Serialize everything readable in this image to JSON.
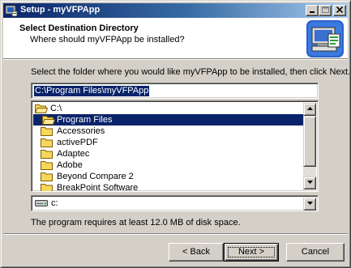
{
  "window": {
    "title": "Setup - myVFPApp",
    "controls": {
      "minimize": "_",
      "maximize": "□",
      "close": "×"
    }
  },
  "header": {
    "title": "Select Destination Directory",
    "subtitle": "Where should myVFPApp be installed?",
    "logo_icon": "computer-install-icon"
  },
  "body": {
    "instruction": "Select the folder where you would like myVFPApp to be installed, then click Next.",
    "path_value": "C:\\Program Files\\myVFPApp",
    "directories": [
      {
        "label": "C:\\",
        "icon": "open-folder-icon",
        "indent": 0,
        "selected": false
      },
      {
        "label": "Program Files",
        "icon": "open-folder-icon",
        "indent": 1,
        "selected": true
      },
      {
        "label": "Accessories",
        "icon": "folder-icon",
        "indent": 2,
        "selected": false
      },
      {
        "label": "activePDF",
        "icon": "folder-icon",
        "indent": 2,
        "selected": false
      },
      {
        "label": "Adaptec",
        "icon": "folder-icon",
        "indent": 2,
        "selected": false
      },
      {
        "label": "Adobe",
        "icon": "folder-icon",
        "indent": 2,
        "selected": false
      },
      {
        "label": "Beyond Compare 2",
        "icon": "folder-icon",
        "indent": 2,
        "selected": false
      },
      {
        "label": "BreakPoint Software",
        "icon": "folder-icon",
        "indent": 2,
        "selected": false
      }
    ],
    "drive": {
      "label": "c:",
      "icon": "drive-icon"
    },
    "space_required": "The program requires at least 12.0 MB of disk space."
  },
  "buttons": {
    "back": "< Back",
    "next": "Next >",
    "cancel": "Cancel"
  },
  "colors": {
    "selection": "#0a246a",
    "dialog_face": "#d4d0c8",
    "folder_yellow": "#f7d65a"
  }
}
